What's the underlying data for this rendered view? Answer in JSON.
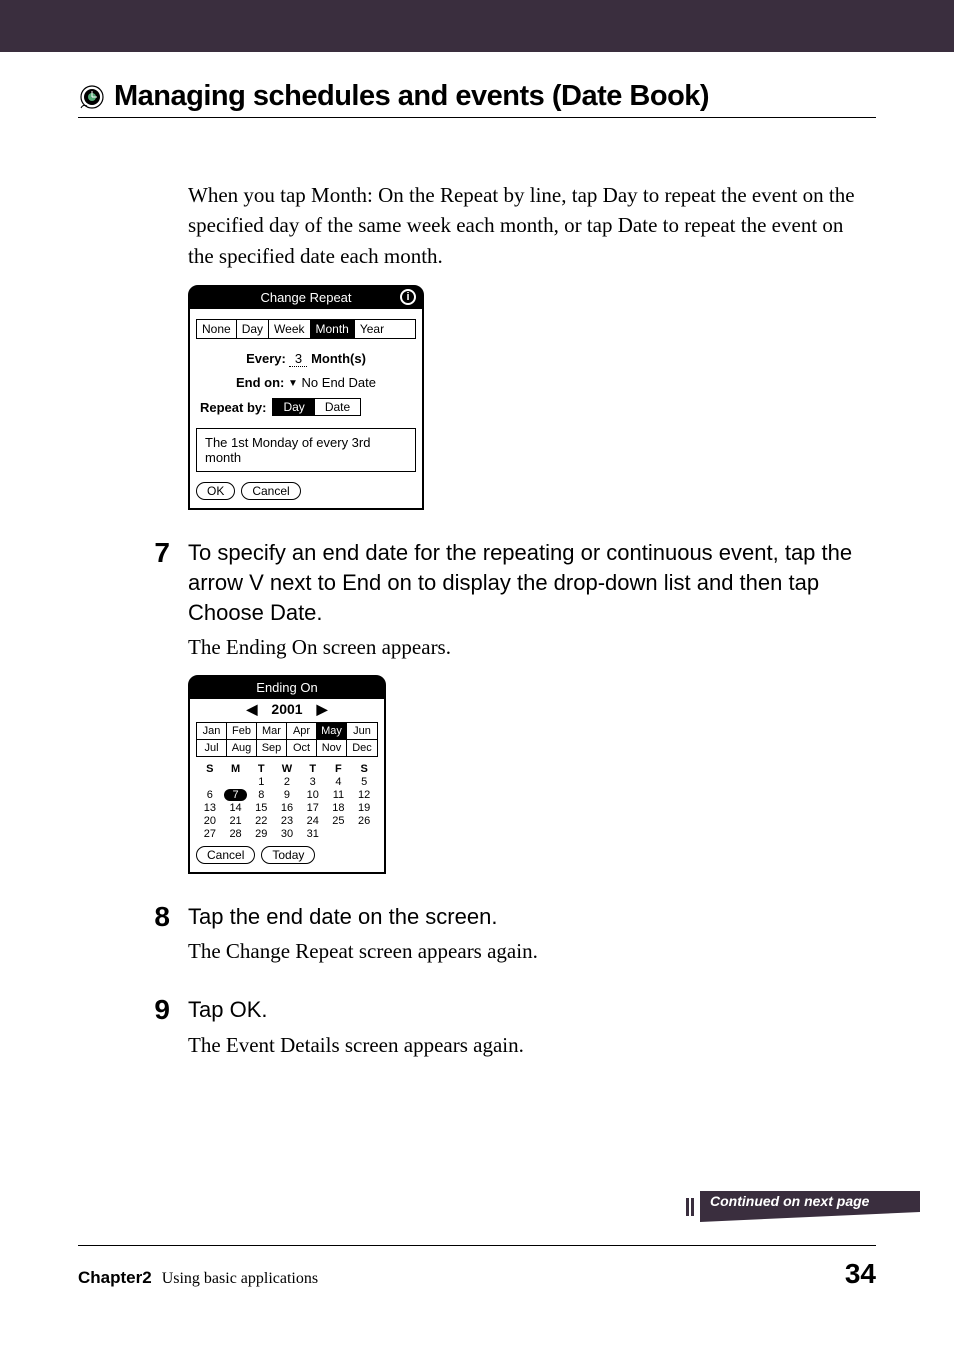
{
  "header": {
    "title": "Managing schedules and events (Date Book)"
  },
  "intro_text": "When you tap Month: On the Repeat by line, tap Day to repeat the event on the specified day of the same week each month, or tap Date to repeat the event on the specified date each month.",
  "change_repeat": {
    "title": "Change Repeat",
    "tabs": [
      "None",
      "Day",
      "Week",
      "Month",
      "Year"
    ],
    "selected_tab": "Month",
    "every_label": "Every:",
    "every_value": "3",
    "every_unit": "Month(s)",
    "end_label": "End on:",
    "end_value": "No End Date",
    "repeat_by_label": "Repeat by:",
    "repeat_by_options": [
      "Day",
      "Date"
    ],
    "repeat_by_selected": "Day",
    "summary": "The 1st Monday of every 3rd month",
    "ok": "OK",
    "cancel": "Cancel"
  },
  "step7": {
    "num": "7",
    "head": "To specify an end date for the repeating or continuous event, tap the arrow V next to End on to display the drop-down list and then tap Choose Date.",
    "body": "The Ending On screen appears."
  },
  "ending_on": {
    "title": "Ending On",
    "year": "2001",
    "months": [
      "Jan",
      "Feb",
      "Mar",
      "Apr",
      "May",
      "Jun",
      "Jul",
      "Aug",
      "Sep",
      "Oct",
      "Nov",
      "Dec"
    ],
    "selected_month": "May",
    "weekdays": [
      "S",
      "M",
      "T",
      "W",
      "T",
      "F",
      "S"
    ],
    "rows": [
      [
        "",
        "",
        "1",
        "2",
        "3",
        "4",
        "5"
      ],
      [
        "6",
        "7",
        "8",
        "9",
        "10",
        "11",
        "12"
      ],
      [
        "13",
        "14",
        "15",
        "16",
        "17",
        "18",
        "19"
      ],
      [
        "20",
        "21",
        "22",
        "23",
        "24",
        "25",
        "26"
      ],
      [
        "27",
        "28",
        "29",
        "30",
        "31",
        "",
        ""
      ]
    ],
    "selected_day": "7",
    "cancel": "Cancel",
    "today": "Today"
  },
  "step8": {
    "num": "8",
    "head": "Tap the end date on the screen.",
    "body": "The Change Repeat screen appears again."
  },
  "step9": {
    "num": "9",
    "head": "Tap OK.",
    "body": "The Event Details screen appears again."
  },
  "continued": "Continued on next page",
  "footer": {
    "chapter": "Chapter2",
    "subtitle": "Using basic applications",
    "page": "34"
  }
}
